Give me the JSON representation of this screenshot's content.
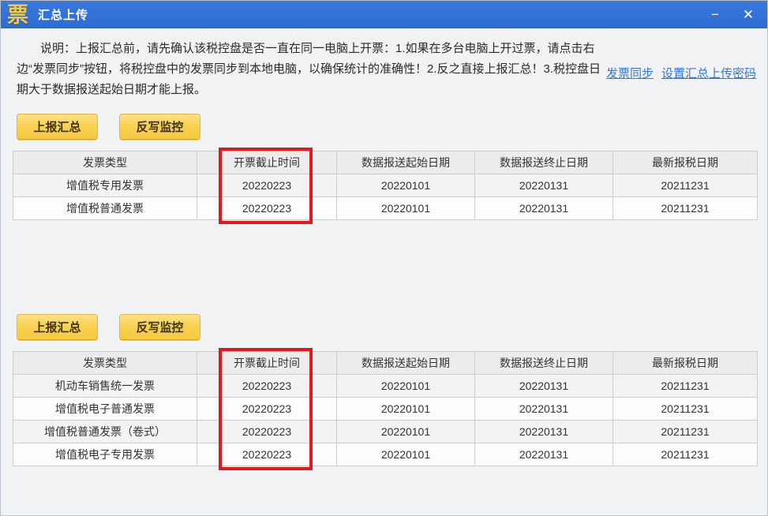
{
  "window": {
    "icon_glyph": "票",
    "title": "汇总上传",
    "minimize_glyph": "−",
    "close_glyph": "✕"
  },
  "description": "说明：上报汇总前，请先确认该税控盘是否一直在同一电脑上开票：1.如果在多台电脑上开过票，请点击右边“发票同步”按钮，将税控盘中的发票同步到本地电脑，以确保统计的准确性！2.反之直接上报汇总！3.税控盘日期大于数据报送起始日期才能上报。",
  "links": {
    "invoice_sync": "发票同步",
    "set_password": "设置汇总上传密码"
  },
  "buttons": {
    "report_summary": "上报汇总",
    "writeback_monitor": "反写监控"
  },
  "headers": [
    "发票类型",
    "开票截止时间",
    "数据报送起始日期",
    "数据报送终止日期",
    "最新报税日期"
  ],
  "table1": {
    "rows": [
      [
        "增值税专用发票",
        "20220223",
        "20220101",
        "20220131",
        "20211231"
      ],
      [
        "增值税普通发票",
        "20220223",
        "20220101",
        "20220131",
        "20211231"
      ]
    ]
  },
  "table2": {
    "rows": [
      [
        "机动车销售统一发票",
        "20220223",
        "20220101",
        "20220131",
        "20211231"
      ],
      [
        "增值税电子普通发票",
        "20220223",
        "20220101",
        "20220131",
        "20211231"
      ],
      [
        "增值税普通发票（卷式）",
        "20220223",
        "20220101",
        "20220131",
        "20211231"
      ],
      [
        "增值税电子专用发票",
        "20220223",
        "20220101",
        "20220131",
        "20211231"
      ]
    ]
  },
  "colors": {
    "titlebar_blue": "#2f70d4",
    "icon_yellow": "#f6c83f",
    "button_yellow": "#f9d252",
    "link_blue": "#3577d4",
    "highlight_red": "#e01a1c"
  }
}
